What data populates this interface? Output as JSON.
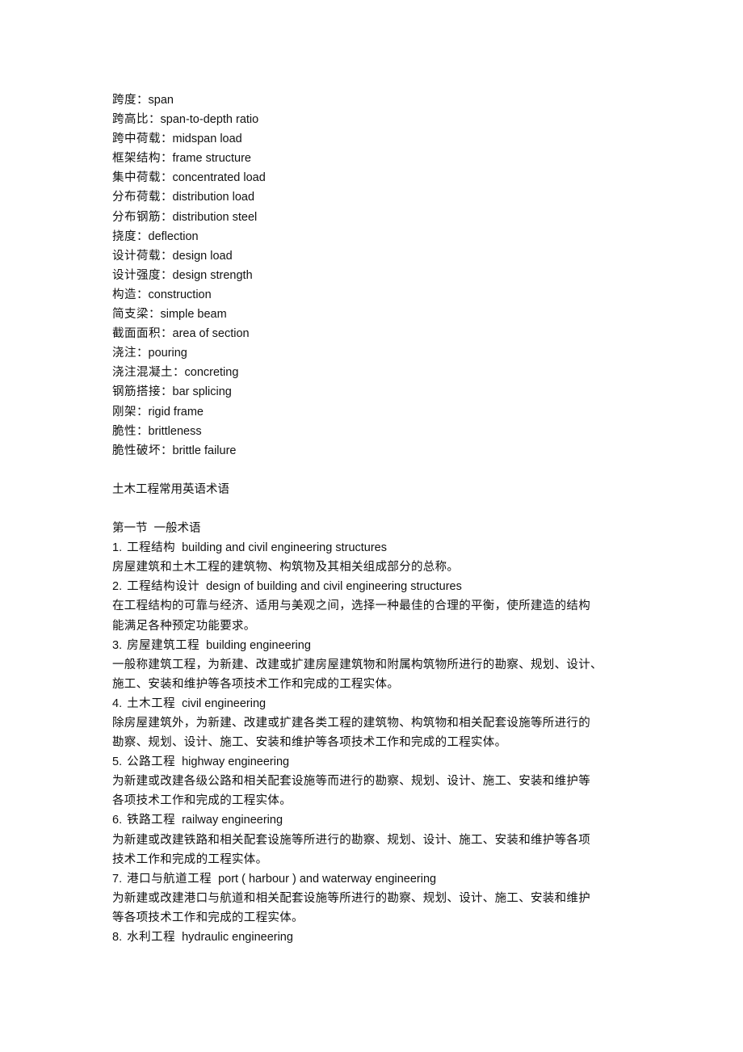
{
  "glossary": [
    {
      "zh": "跨度",
      "en": "span"
    },
    {
      "zh": "跨高比",
      "en": "span-to-depth ratio"
    },
    {
      "zh": "跨中荷载",
      "en": "midspan load"
    },
    {
      "zh": "框架结构",
      "en": "frame structure"
    },
    {
      "zh": "集中荷载",
      "en": "concentrated load"
    },
    {
      "zh": "分布荷载",
      "en": "distribution load"
    },
    {
      "zh": "分布钢筋",
      "en": "distribution steel"
    },
    {
      "zh": "挠度",
      "en": "deflection"
    },
    {
      "zh": "设计荷载",
      "en": "design load"
    },
    {
      "zh": "设计强度",
      "en": "design strength"
    },
    {
      "zh": "构造",
      "en": "construction"
    },
    {
      "zh": "简支梁",
      "en": "simple beam"
    },
    {
      "zh": "截面面积",
      "en": "area of section"
    },
    {
      "zh": "浇注",
      "en": "pouring"
    },
    {
      "zh": "浇注混凝土",
      "en": "concreting"
    },
    {
      "zh": "钢筋搭接",
      "en": "bar splicing"
    },
    {
      "zh": "刚架",
      "en": "rigid frame"
    },
    {
      "zh": "脆性",
      "en": "brittleness"
    },
    {
      "zh": "脆性破坏",
      "en": "brittle failure"
    }
  ],
  "separator": "：",
  "doc_title": "土木工程常用英语术语",
  "section_title": "第一节  一般术语",
  "terms": [
    {
      "num": "1.",
      "zh": "工程结构",
      "en": "building and civil engineering structures",
      "desc": [
        "房屋建筑和土木工程的建筑物、构筑物及其相关组成部分的总称。"
      ]
    },
    {
      "num": "2.",
      "zh": "工程结构设计",
      "en": "design of building and civil engineering structures",
      "desc": [
        "在工程结构的可靠与经济、适用与美观之间，选择一种最佳的合理的平衡，使所建造的结构",
        "能满足各种预定功能要求。"
      ]
    },
    {
      "num": "3.",
      "zh": "房屋建筑工程",
      "en": "building engineering",
      "desc": [
        "一般称建筑工程，为新建、改建或扩建房屋建筑物和附属构筑物所进行的勘察、规划、设计、",
        "施工、安装和维护等各项技术工作和完成的工程实体。"
      ]
    },
    {
      "num": "4.",
      "zh": "土木工程",
      "en": "civil engineering",
      "desc": [
        "除房屋建筑外，为新建、改建或扩建各类工程的建筑物、构筑物和相关配套设施等所进行的",
        "勘察、规划、设计、施工、安装和维护等各项技术工作和完成的工程实体。"
      ]
    },
    {
      "num": "5.",
      "zh": "公路工程",
      "en": "highway engineering",
      "desc": [
        "为新建或改建各级公路和相关配套设施等而进行的勘察、规划、设计、施工、安装和维护等",
        "各项技术工作和完成的工程实体。"
      ]
    },
    {
      "num": "6.",
      "zh": "铁路工程",
      "en": "railway engineering",
      "desc": [
        "为新建或改建铁路和相关配套设施等所进行的勘察、规划、设计、施工、安装和维护等各项",
        "技术工作和完成的工程实体。"
      ]
    },
    {
      "num": "7.",
      "zh": "港口与航道工程",
      "en": "port ( harbour ) and waterway engineering",
      "desc": [
        "为新建或改建港口与航道和相关配套设施等所进行的勘察、规划、设计、施工、安装和维护",
        "等各项技术工作和完成的工程实体。"
      ]
    },
    {
      "num": "8.",
      "zh": "水利工程",
      "en": "hydraulic engineering",
      "desc": []
    }
  ]
}
